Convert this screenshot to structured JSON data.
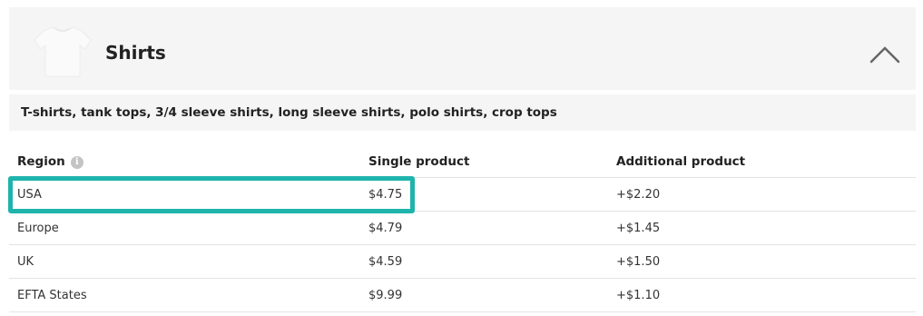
{
  "product": {
    "title": "Shirts",
    "image_icon": "tshirt-icon",
    "toggle_icon": "chevron-up-icon",
    "description": "T-shirts, tank tops, 3/4 sleeve shirts, long sleeve shirts, polo shirts, crop tops"
  },
  "table": {
    "headers": {
      "region": "Region",
      "single": "Single product",
      "additional": "Additional product"
    },
    "info_icon": "i",
    "rows": [
      {
        "region": "USA",
        "single": "$4.75",
        "additional": "+$2.20"
      },
      {
        "region": "Europe",
        "single": "$4.79",
        "additional": "+$1.45"
      },
      {
        "region": "UK",
        "single": "$4.59",
        "additional": "+$1.50"
      },
      {
        "region": "EFTA States",
        "single": "$9.99",
        "additional": "+$1.10"
      }
    ]
  },
  "colors": {
    "highlight": "#1eb4ac",
    "header_bg": "#f5f5f5",
    "divider": "#e3e3e3"
  }
}
